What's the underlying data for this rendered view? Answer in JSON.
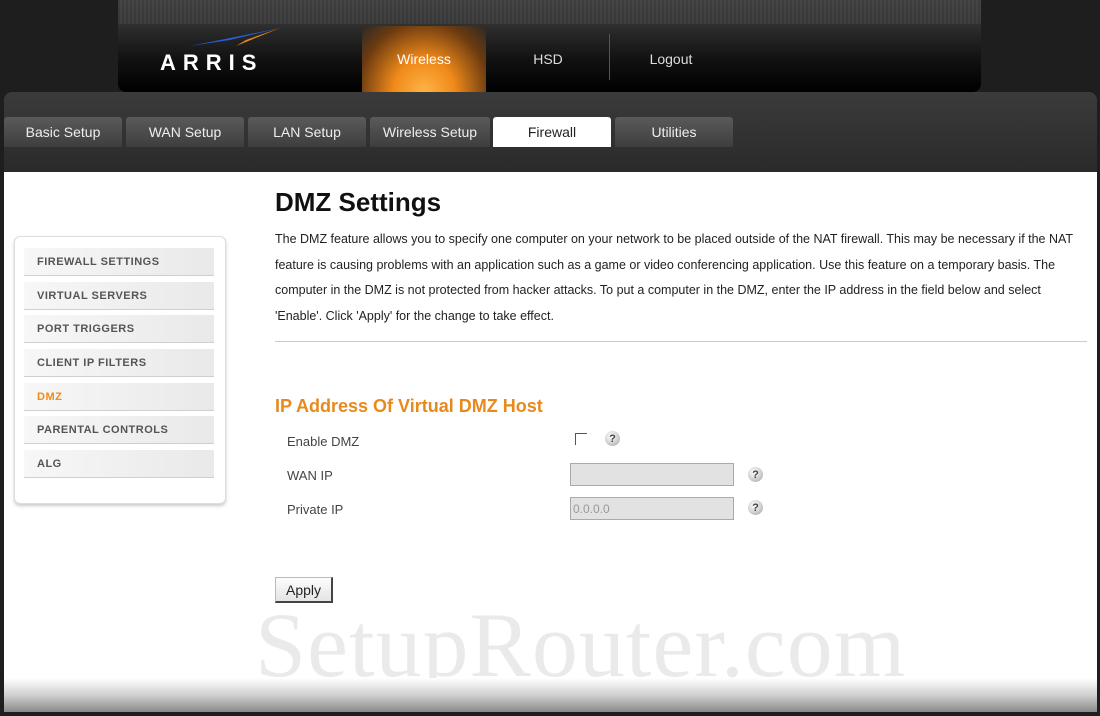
{
  "header": {
    "logo_text": "ARRIS",
    "nav": [
      {
        "label": "Wireless",
        "active": true
      },
      {
        "label": "HSD",
        "active": false
      },
      {
        "label": "Logout",
        "active": false
      }
    ]
  },
  "tabs": [
    {
      "label": "Basic Setup",
      "active": false
    },
    {
      "label": "WAN Setup",
      "active": false
    },
    {
      "label": "LAN Setup",
      "active": false
    },
    {
      "label": "Wireless Setup",
      "active": false
    },
    {
      "label": "Firewall",
      "active": true
    },
    {
      "label": "Utilities",
      "active": false
    }
  ],
  "sidebar": {
    "items": [
      {
        "label": "FIREWALL SETTINGS",
        "active": false
      },
      {
        "label": "VIRTUAL SERVERS",
        "active": false
      },
      {
        "label": "PORT TRIGGERS",
        "active": false
      },
      {
        "label": "CLIENT IP FILTERS",
        "active": false
      },
      {
        "label": "DMZ",
        "active": true
      },
      {
        "label": "PARENTAL CONTROLS",
        "active": false
      },
      {
        "label": "ALG",
        "active": false
      }
    ]
  },
  "main": {
    "title": "DMZ Settings",
    "description": "The DMZ feature allows you to specify one computer on your network to be placed outside of the NAT firewall. This may be necessary if the NAT feature is causing problems with an application such as a game or video conferencing application. Use this feature on a temporary basis. The computer in the DMZ is not protected from hacker attacks. To put a computer in the DMZ, enter the IP address in the field below and select 'Enable'. Click 'Apply' for the change to take effect.",
    "section_title": "IP Address Of Virtual DMZ Host",
    "form": {
      "enable_dmz_label": "Enable DMZ",
      "enable_dmz_checked": false,
      "wan_ip_label": "WAN IP",
      "wan_ip_value": "",
      "private_ip_label": "Private IP",
      "private_ip_value": "0.0.0.0",
      "help_glyph": "?"
    },
    "apply_label": "Apply"
  },
  "watermark": "SetupRouter.com",
  "colors": {
    "accent": "#e8891c",
    "active_tab_bg": "#ffffff"
  }
}
